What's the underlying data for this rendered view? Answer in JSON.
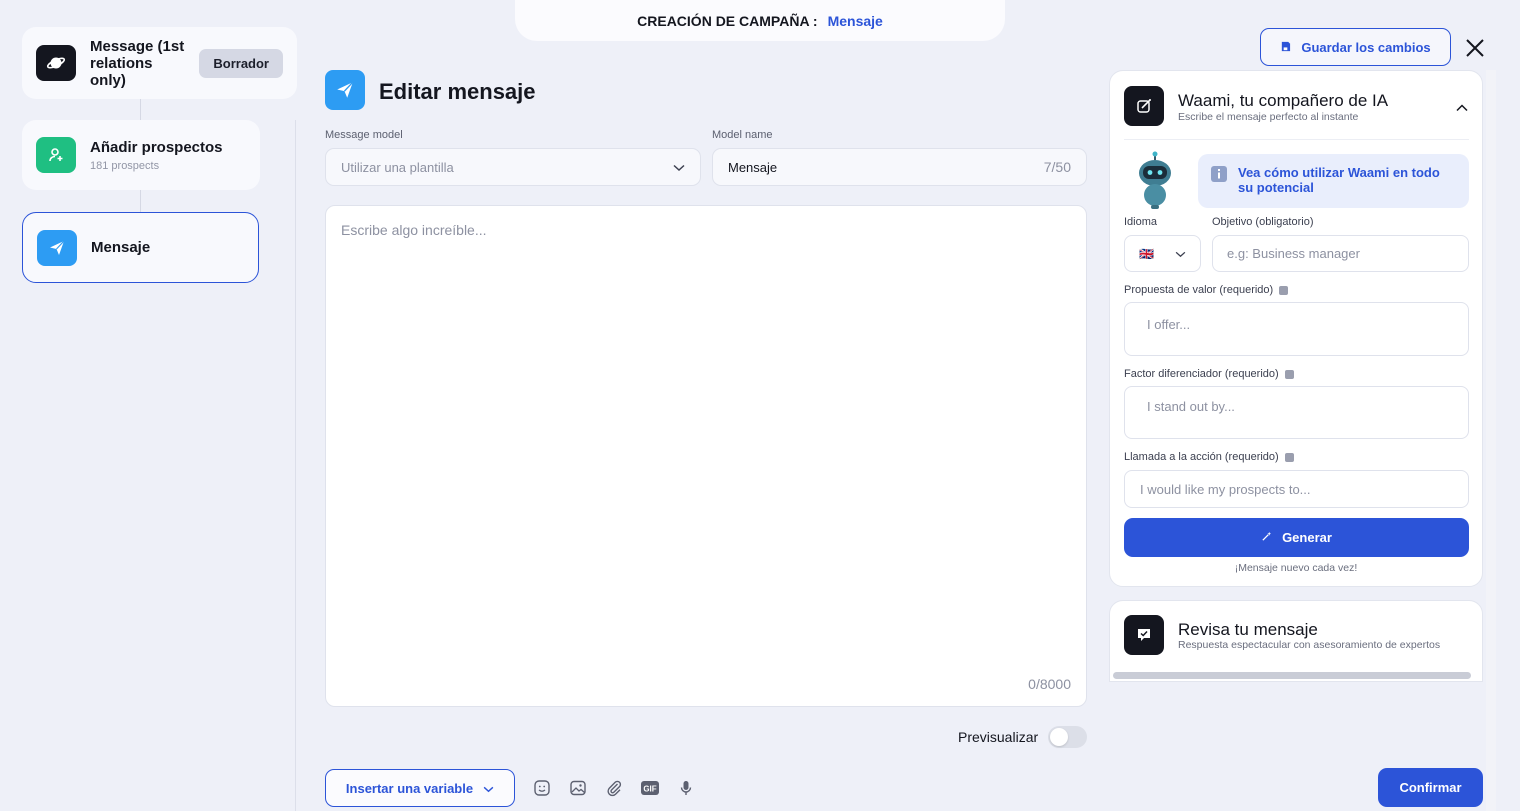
{
  "header": {
    "label": "CREACIÓN DE CAMPAÑA :",
    "current": "Mensaje"
  },
  "sidebar": {
    "steps": [
      {
        "title": "Message (1st relations only)",
        "badge": "Borrador",
        "icon": "planet-icon"
      },
      {
        "title": "Añadir prospectos",
        "subtitle": "181 prospects",
        "icon": "add-user-icon"
      },
      {
        "title": "Mensaje",
        "icon": "paper-plane-icon"
      }
    ]
  },
  "main": {
    "title": "Editar mensaje",
    "model_label": "Message model",
    "model_placeholder": "Utilizar una plantilla",
    "name_label": "Model name",
    "name_value": "Mensaje",
    "name_count": "7/50",
    "message_placeholder": "Escribe algo increíble...",
    "message_count": "0/8000",
    "preview_label": "Previsualizar",
    "preview_enabled": false,
    "insert_variable": "Insertar una variable",
    "tools": [
      "emoji-icon",
      "image-icon",
      "attachment-icon",
      "gif-icon",
      "microphone-icon"
    ]
  },
  "toolbar": {
    "save_label": "Guardar los cambios",
    "confirm_label": "Confirmar"
  },
  "ai": {
    "title": "Waami, tu compañero de IA",
    "subtitle": "Escribe el mensaje perfecto al instante",
    "tip": "Vea cómo utilizar Waami en todo su potencial",
    "language_label": "Idioma",
    "language_flag": "🇬🇧",
    "objective_label": "Objetivo (obligatorio)",
    "objective_placeholder": "e.g: Business manager",
    "value_label": "Propuesta de valor (requerido)",
    "value_placeholder": "I offer...",
    "diff_label": "Factor diferenciador (requerido)",
    "diff_placeholder": "I stand out by...",
    "cta_label": "Llamada a la acción (requerido)",
    "cta_placeholder": "I would like my prospects to...",
    "generate_label": "Generar",
    "generate_note": "¡Mensaje nuevo cada vez!"
  },
  "review": {
    "title": "Revisa tu mensaje",
    "subtitle": "Respuesta espectacular con asesoramiento de expertos"
  },
  "colors": {
    "accent": "#2c54d8",
    "sky": "#2d9cf3",
    "green": "#1fbf82",
    "dark": "#14161f"
  }
}
